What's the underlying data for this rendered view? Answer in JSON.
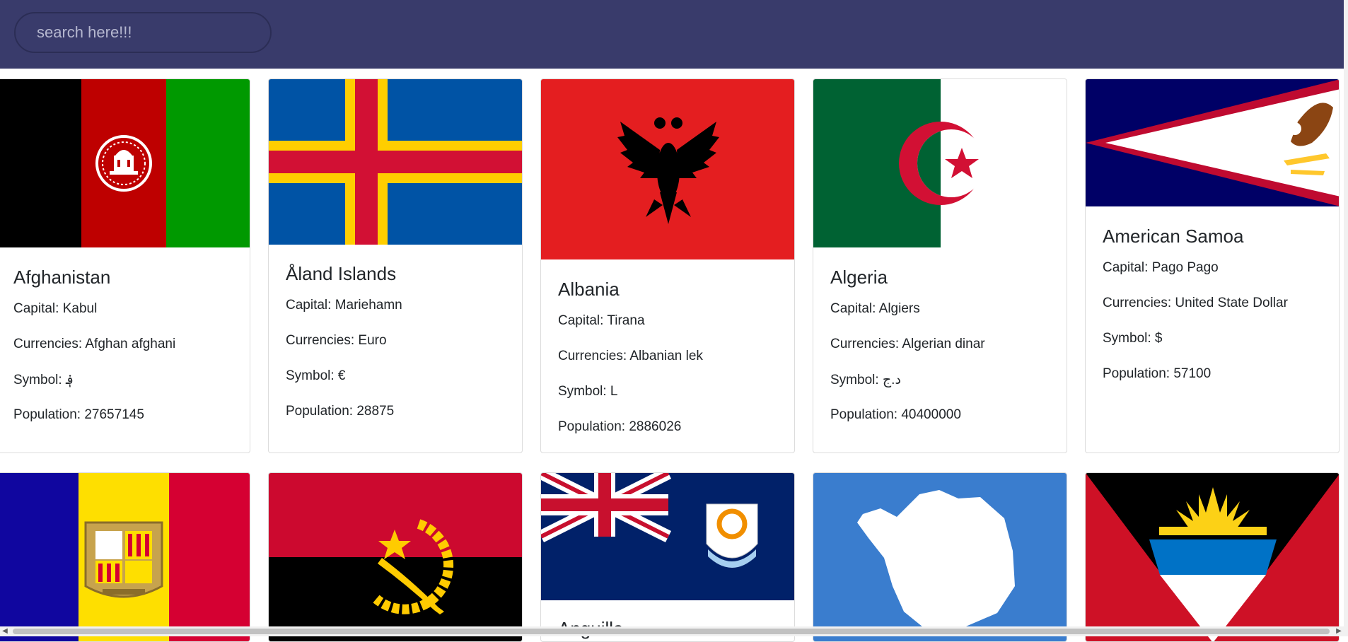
{
  "search": {
    "placeholder": "search here!!!"
  },
  "labels": {
    "capital": "Capital: ",
    "currencies": "Currencies: ",
    "symbol": "Symbol: ",
    "population": "Population: "
  },
  "countries": [
    {
      "name": "Afghanistan",
      "capital": "Kabul",
      "currency": "Afghan afghani",
      "symbol": "؋",
      "population": "27657145",
      "flag": "afghanistan-flag"
    },
    {
      "name": "Åland Islands",
      "capital": "Mariehamn",
      "currency": "Euro",
      "symbol": "€",
      "population": "28875",
      "flag": "aland-islands-flag"
    },
    {
      "name": "Albania",
      "capital": "Tirana",
      "currency": "Albanian lek",
      "symbol": "L",
      "population": "2886026",
      "flag": "albania-flag"
    },
    {
      "name": "Algeria",
      "capital": "Algiers",
      "currency": "Algerian dinar",
      "symbol": "د.ج",
      "population": "40400000",
      "flag": "algeria-flag"
    },
    {
      "name": "American Samoa",
      "capital": "Pago Pago",
      "currency": "United State Dollar",
      "symbol": "$",
      "population": "57100",
      "flag": "american-samoa-flag"
    },
    {
      "flag": "andorra-flag"
    },
    {
      "flag": "angola-flag"
    },
    {
      "name": "Anguilla",
      "flag": "anguilla-flag"
    },
    {
      "flag": "antarctica-flag"
    },
    {
      "flag": "antigua-and-barbuda-flag"
    }
  ],
  "colors": {
    "header_bg": "#393b6b",
    "card_border": "#dcdcdc",
    "text": "#212529"
  }
}
